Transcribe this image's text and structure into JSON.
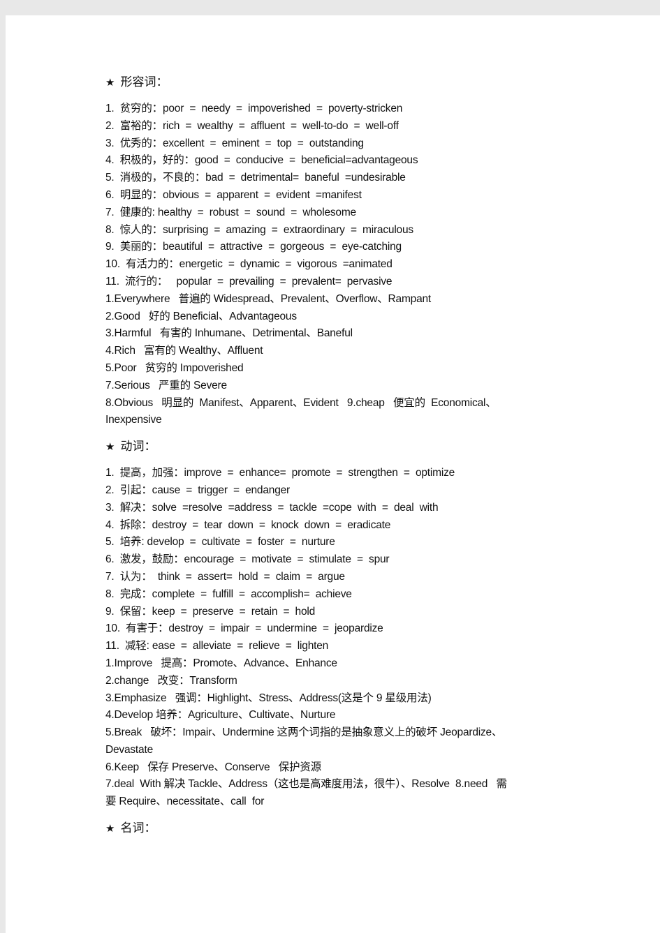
{
  "sections": [
    {
      "star": "★",
      "title": "形容词：",
      "lines": [
        "1.  贫穷的：poor  =  needy  =  impoverished  =  poverty-stricken",
        "2.  富裕的：rich  =  wealthy  =  affluent  =  well-to-do  =  well-off",
        "3.  优秀的：excellent  =  eminent  =  top  =  outstanding",
        "4.  积极的，好的：good  =  conducive  =  beneficial=advantageous",
        "5.  消极的，不良的：bad  =  detrimental=  baneful  =undesirable",
        "6.  明显的：obvious  =  apparent  =  evident  =manifest",
        "7.  健康的: healthy  =  robust  =  sound  =  wholesome",
        "8.  惊人的：surprising  =  amazing  =  extraordinary  =  miraculous",
        "9.  美丽的：beautiful  =  attractive  =  gorgeous  =  eye-catching",
        "10.  有活力的：energetic  =  dynamic  =  vigorous  =animated",
        "11.  流行的：   popular  =  prevailing  =  prevalent=  pervasive",
        "1.Everywhere   普遍的 Widespread、Prevalent、Overflow、Rampant",
        "2.Good   好的 Beneficial、Advantageous",
        "3.Harmful   有害的 Inhumane、Detrimental、Baneful",
        "4.Rich   富有的 Wealthy、Affluent",
        "5.Poor   贫穷的 Impoverished",
        "7.Serious   严重的 Severe",
        "8.Obvious   明显的  Manifest、Apparent、Evident   9.cheap   便宜的  Economical、",
        "Inexpensive"
      ]
    },
    {
      "star": "★",
      "title": "动词：",
      "lines": [
        "1.  提高，加强：improve  =  enhance=  promote  =  strengthen  =  optimize",
        "2.  引起：cause  =  trigger  =  endanger",
        "3.  解决：solve  =resolve  =address  =  tackle  =cope  with  =  deal  with",
        "4.  拆除：destroy  =  tear  down  =  knock  down  =  eradicate",
        "5.  培养: develop  =  cultivate  =  foster  =  nurture",
        "6.  激发，鼓励：encourage  =  motivate  =  stimulate  =  spur",
        "7.  认为：  think  =  assert=  hold  =  claim  =  argue",
        "8.  完成：complete  =  fulfill  =  accomplish=  achieve",
        "9.  保留：keep  =  preserve  =  retain  =  hold",
        "10.  有害于：destroy  =  impair  =  undermine  =  jeopardize",
        "11.  减轻: ease  =  alleviate  =  relieve  =  lighten",
        "1.Improve   提高：Promote、Advance、Enhance",
        "2.change   改变：Transform",
        "3.Emphasize   强调：Highlight、Stress、Address(这是个 9 星级用法)",
        "4.Develop 培养：Agriculture、Cultivate、Nurture",
        "5.Break   破坏：Impair、Undermine 这两个词指的是抽象意义上的破坏 Jeopardize、",
        "Devastate",
        "6.Keep   保存 Preserve、Conserve   保护资源",
        "7.deal  With 解决 Tackle、Address（这也是高难度用法，很牛）、Resolve  8.need   需",
        "要 Require、necessitate、call  for"
      ]
    },
    {
      "star": "★",
      "title": "名词：",
      "lines": []
    }
  ]
}
